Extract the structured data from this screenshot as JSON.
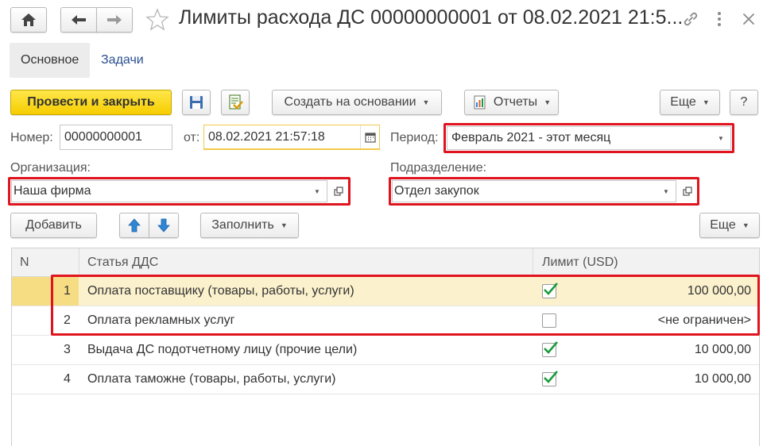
{
  "window": {
    "title": "Лимиты расхода ДС 00000000001 от 08.02.2021 21:5..."
  },
  "tabs": [
    {
      "label": "Основное"
    },
    {
      "label": "Задачи"
    }
  ],
  "toolbar": {
    "post_close": "Провести и закрыть",
    "create_based": "Создать на основании",
    "reports": "Отчеты",
    "more": "Еще",
    "help": "?"
  },
  "form": {
    "number_label": "Номер:",
    "number_value": "00000000001",
    "date_label": "от:",
    "date_value": "08.02.2021 21:57:18",
    "period_label": "Период:",
    "period_value": "Февраль 2021 - этот месяц",
    "org_label": "Организация:",
    "org_value": "Наша фирма",
    "dept_label": "Подразделение:",
    "dept_value": "Отдел закупок"
  },
  "table_toolbar": {
    "add": "Добавить",
    "fill": "Заполнить",
    "more": "Еще"
  },
  "table": {
    "columns": [
      "N",
      "Статья ДДС",
      "Лимит (USD)"
    ],
    "rows": [
      {
        "n": "1",
        "item": "Оплата поставщику (товары, работы, услуги)",
        "checked": true,
        "limit": "100 000,00"
      },
      {
        "n": "2",
        "item": "Оплата рекламных услуг",
        "checked": false,
        "limit": "<не ограничен>"
      },
      {
        "n": "3",
        "item": "Выдача ДС подотчетному лицу (прочие цели)",
        "checked": true,
        "limit": "10 000,00"
      },
      {
        "n": "4",
        "item": "Оплата таможне (товары, работы, услуги)",
        "checked": true,
        "limit": "10 000,00"
      }
    ]
  },
  "colors": {
    "accent_yellow": "#f6cd00",
    "highlight_red": "#e0141e",
    "selected_row": "#fbf1cd",
    "check_green": "#1a9b3b",
    "arrow_blue": "#2f86d6"
  }
}
